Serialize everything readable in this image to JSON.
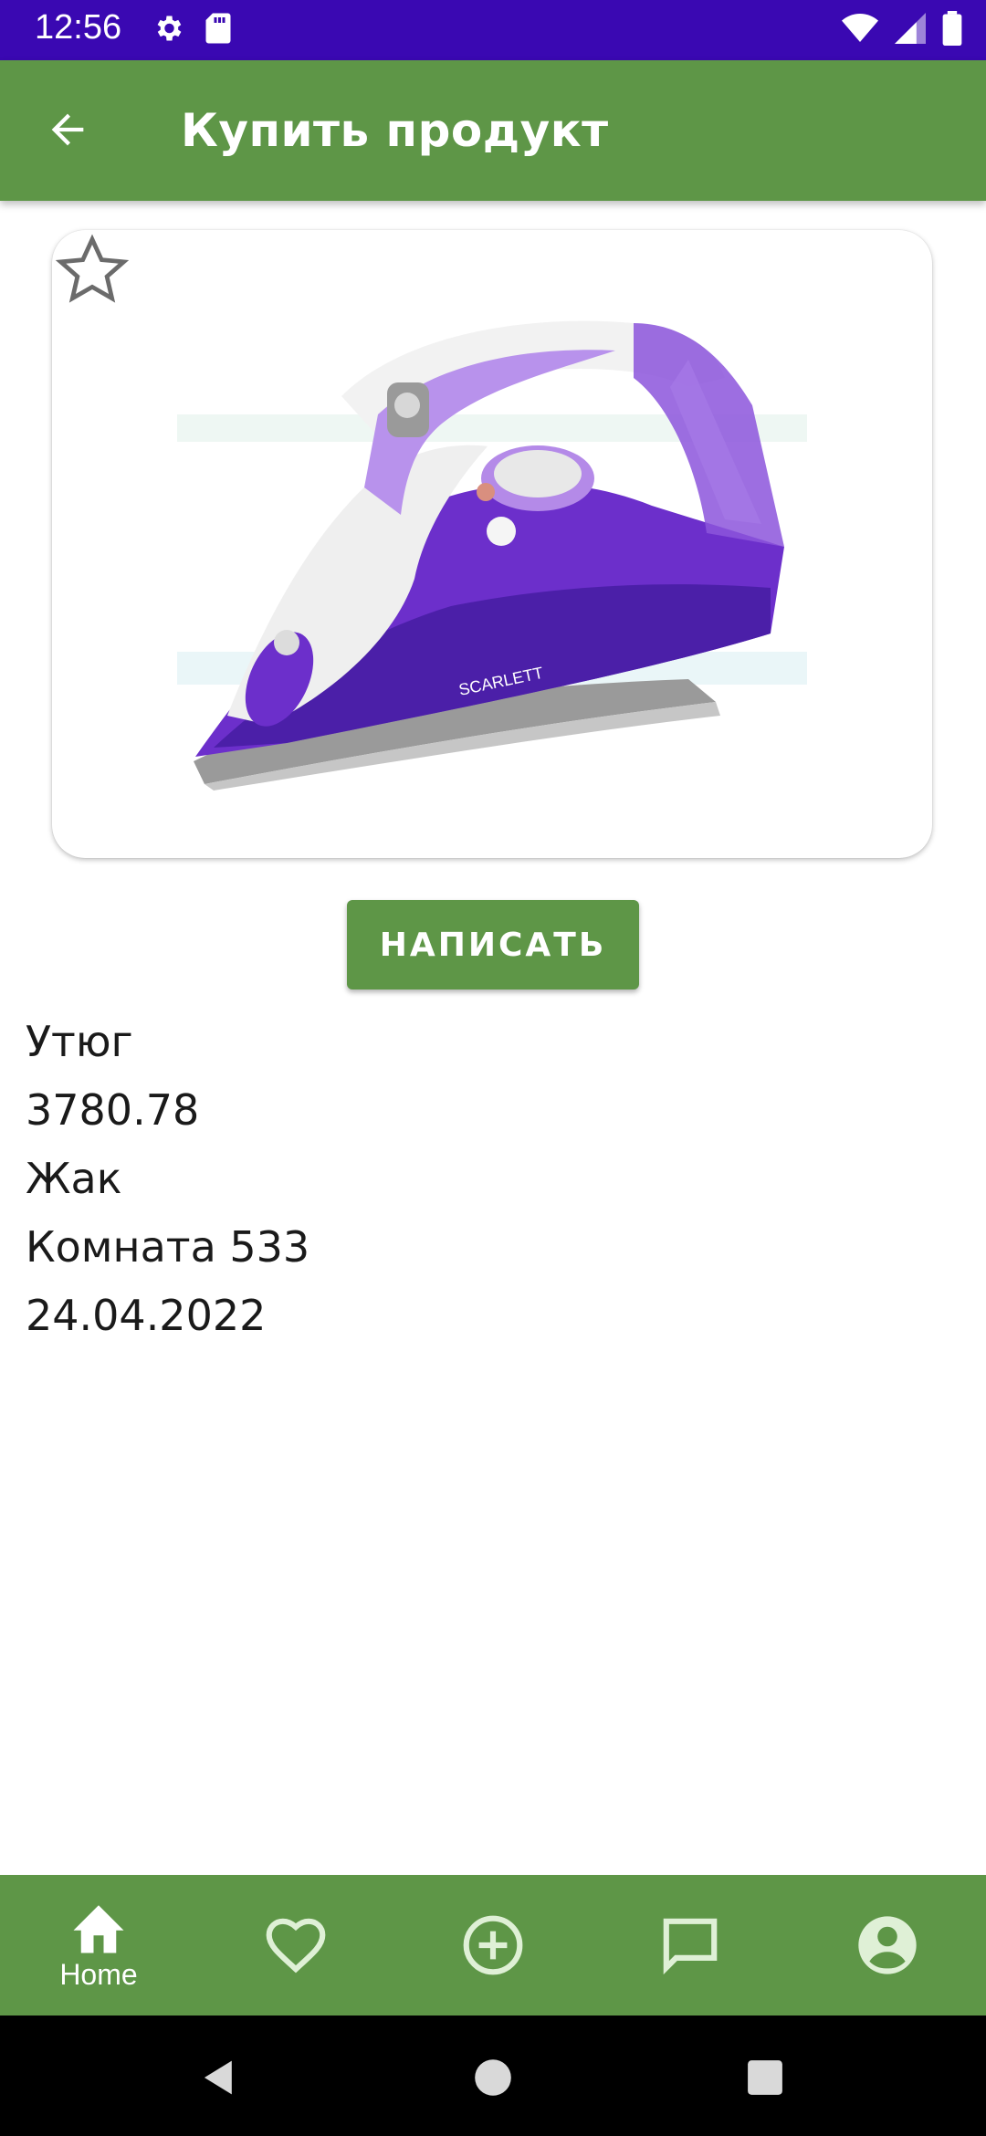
{
  "status_bar": {
    "time": "12:56",
    "icons": [
      "settings-icon",
      "sd-card-icon",
      "wifi-icon",
      "signal-icon",
      "battery-icon"
    ]
  },
  "app_bar": {
    "title": "Купить продукт",
    "back_icon": "arrow-back-icon"
  },
  "product": {
    "favorite_icon": "star-outline-icon",
    "image_brand": "SCARLETT",
    "name": "Утюг",
    "price": "3780.78",
    "seller": "Жак",
    "room": "Комната 533",
    "date": "24.04.2022"
  },
  "actions": {
    "write_label": "НАПИСАТЬ"
  },
  "bottom_nav": {
    "items": [
      {
        "icon": "home-icon",
        "label": "Home"
      },
      {
        "icon": "heart-icon",
        "label": ""
      },
      {
        "icon": "add-circle-icon",
        "label": ""
      },
      {
        "icon": "chat-icon",
        "label": ""
      },
      {
        "icon": "account-icon",
        "label": ""
      }
    ]
  },
  "colors": {
    "status_bar": "#3a08b2",
    "primary": "#5e9647",
    "text": "#1a1a1a"
  }
}
